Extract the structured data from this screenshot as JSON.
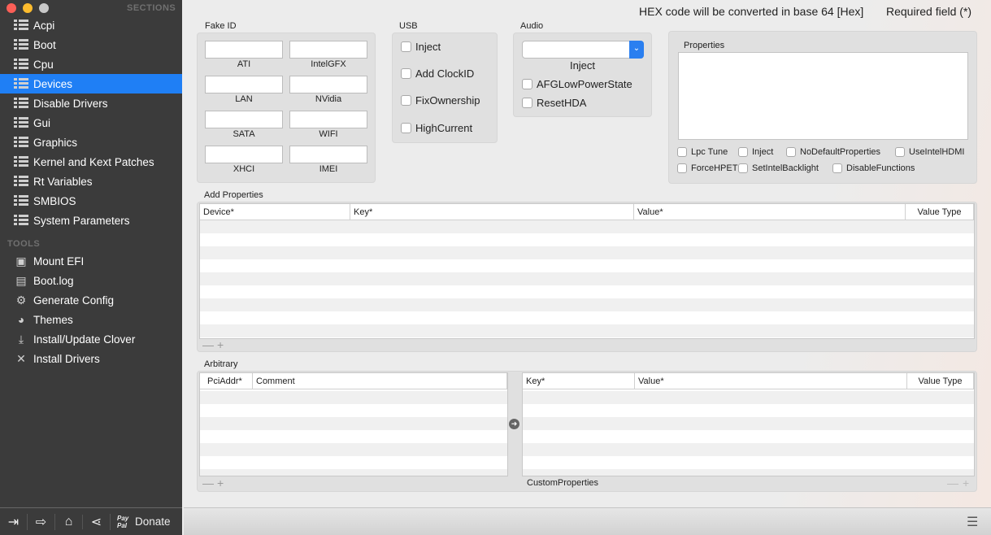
{
  "sidebar": {
    "sections_header": "SECTIONS",
    "sections": [
      "Acpi",
      "Boot",
      "Cpu",
      "Devices",
      "Disable Drivers",
      "Gui",
      "Graphics",
      "Kernel and Kext Patches",
      "Rt Variables",
      "SMBIOS",
      "System Parameters"
    ],
    "selected": "Devices",
    "tools_header": "TOOLS",
    "tools": [
      {
        "label": "Mount EFI",
        "icon": "disk-icon"
      },
      {
        "label": "Boot.log",
        "icon": "log-icon"
      },
      {
        "label": "Generate Config",
        "icon": "gears-icon"
      },
      {
        "label": "Themes",
        "icon": "palette-icon"
      },
      {
        "label": "Install/Update Clover",
        "icon": "download-icon"
      },
      {
        "label": "Install Drivers",
        "icon": "wrench-icon"
      }
    ],
    "footer": {
      "paypal": "Pay Pal",
      "donate": "Donate"
    }
  },
  "header": {
    "hex_note": "HEX code will be converted in base 64 [Hex]",
    "required_note": "Required field (*)"
  },
  "fake_id": {
    "title": "Fake ID",
    "fields": [
      {
        "label": "ATI",
        "value": ""
      },
      {
        "label": "IntelGFX",
        "value": ""
      },
      {
        "label": "LAN",
        "value": ""
      },
      {
        "label": "NVidia",
        "value": ""
      },
      {
        "label": "SATA",
        "value": ""
      },
      {
        "label": "WIFI",
        "value": ""
      },
      {
        "label": "XHCI",
        "value": ""
      },
      {
        "label": "IMEI",
        "value": ""
      }
    ]
  },
  "usb": {
    "title": "USB",
    "options": [
      "Inject",
      "Add ClockID",
      "FixOwnership",
      "HighCurrent"
    ]
  },
  "audio": {
    "title": "Audio",
    "select_value": "",
    "select_label": "Inject",
    "options": [
      "AFGLowPowerState",
      "ResetHDA"
    ]
  },
  "properties": {
    "title": "Properties",
    "value": "",
    "options": [
      "Lpc Tune",
      "Inject",
      "NoDefaultProperties",
      "UseIntelHDMI",
      "ForceHPET",
      "SetIntelBacklight",
      "DisableFunctions"
    ]
  },
  "add_properties": {
    "title": "Add Properties",
    "columns": [
      "Device*",
      "Key*",
      "Value*",
      "Value Type"
    ],
    "minus": "—",
    "plus": "+"
  },
  "arbitrary": {
    "title": "Arbitrary",
    "left_columns": [
      "PciAddr*",
      "Comment"
    ],
    "right_columns": [
      "Key*",
      "Value*",
      "Value Type"
    ],
    "custom_label": "CustomProperties",
    "minus": "—",
    "plus": "+"
  }
}
